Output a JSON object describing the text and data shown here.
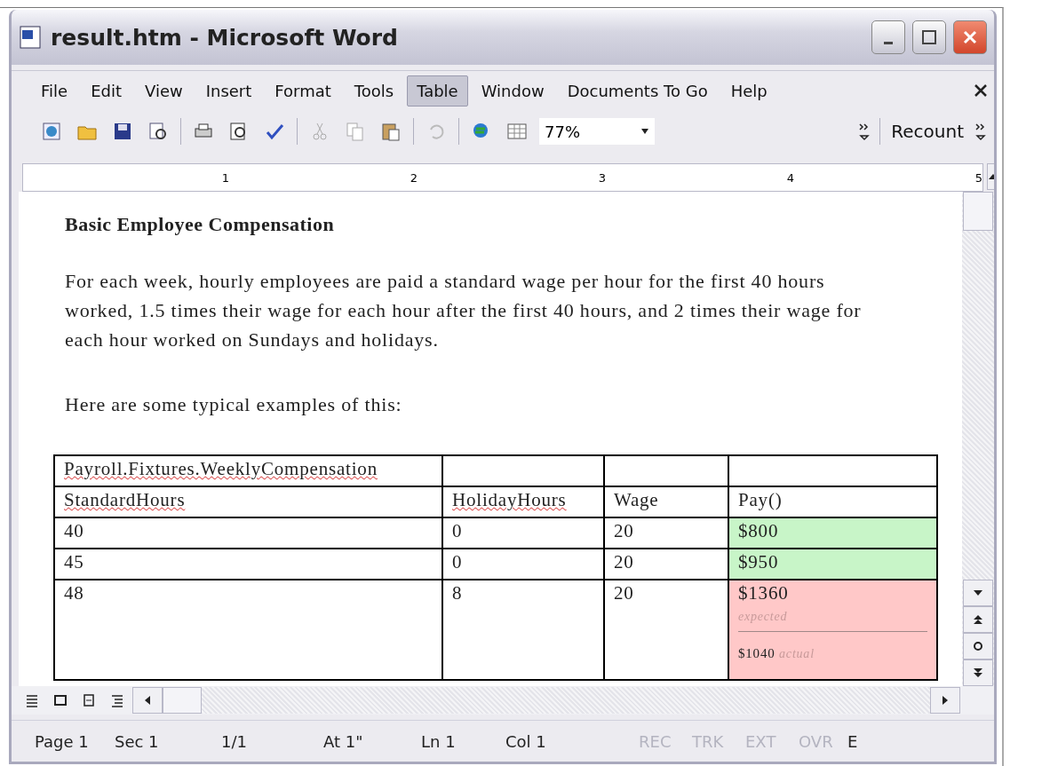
{
  "window": {
    "title": "result.htm - Microsoft Word"
  },
  "menu": [
    {
      "label": "File",
      "selected": false
    },
    {
      "label": "Edit",
      "selected": false
    },
    {
      "label": "View",
      "selected": false
    },
    {
      "label": "Insert",
      "selected": false
    },
    {
      "label": "Format",
      "selected": false
    },
    {
      "label": "Tools",
      "selected": false
    },
    {
      "label": "Table",
      "selected": true
    },
    {
      "label": "Window",
      "selected": false
    },
    {
      "label": "Documents To Go",
      "selected": false
    },
    {
      "label": "Help",
      "selected": false
    }
  ],
  "toolbar": {
    "zoom": "77%",
    "recount": "Recount"
  },
  "ruler": {
    "marks": [
      "1",
      "2",
      "3",
      "4",
      "5"
    ]
  },
  "document": {
    "heading": "Basic Employee Compensation",
    "paragraphs": [
      "For each week, hourly employees are paid a standard wage per hour for the first 40 hours worked, 1.5 times their wage for each hour after the first 40 hours, and 2 times their wage for each hour worked on Sundays and holidays.",
      "Here are some typical examples of this:"
    ],
    "table": {
      "fixture": {
        "text": "Payroll.Fixtures.WeeklyCompensation",
        "misspelled": true
      },
      "columns": [
        {
          "text": "StandardHours",
          "misspelled": true
        },
        {
          "text": "HolidayHours",
          "misspelled": true
        },
        {
          "text": "Wage",
          "misspelled": false
        },
        {
          "text": "Pay()",
          "misspelled": false
        }
      ],
      "rows": [
        {
          "cells": [
            "40",
            "0",
            "20"
          ],
          "pay": {
            "passed": true,
            "value": "$800"
          }
        },
        {
          "cells": [
            "45",
            "0",
            "20"
          ],
          "pay": {
            "passed": true,
            "value": "$950"
          }
        },
        {
          "cells": [
            "48",
            "8",
            "20"
          ],
          "pay": {
            "passed": false,
            "value": "$1360",
            "expected_label": "expected",
            "actual": "$1040",
            "actual_label": "actual"
          }
        }
      ]
    }
  },
  "status_bar": [
    {
      "text": "Page 1",
      "disabled": false
    },
    {
      "text": "Sec 1",
      "disabled": false
    },
    {
      "text": "1/1",
      "disabled": false
    },
    {
      "text": "At 1\"",
      "disabled": false
    },
    {
      "text": "Ln 1",
      "disabled": false
    },
    {
      "text": "Col 1",
      "disabled": false
    },
    {
      "text": "REC",
      "disabled": true
    },
    {
      "text": "TRK",
      "disabled": true
    },
    {
      "text": "EXT",
      "disabled": true
    },
    {
      "text": "OVR",
      "disabled": true
    },
    {
      "text": "E",
      "disabled": false
    }
  ]
}
